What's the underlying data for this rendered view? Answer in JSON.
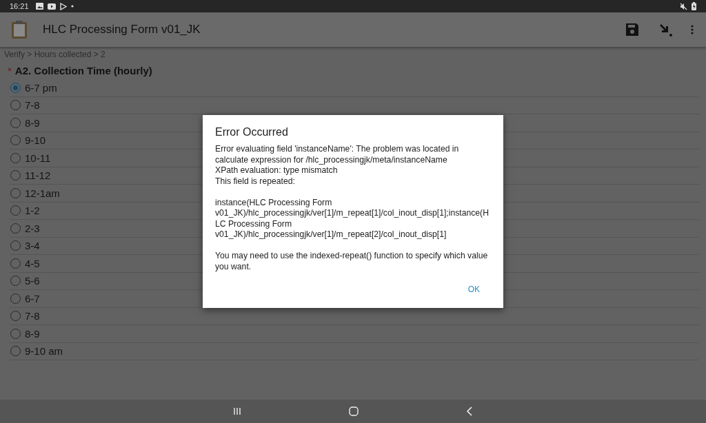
{
  "status_bar": {
    "time": "16:21"
  },
  "app_bar": {
    "title": "HLC Processing Form v01_JK"
  },
  "breadcrumb": "Verify > Hours collected > 2",
  "question": {
    "required": true,
    "required_mark": "*",
    "label": "A2. Collection Time (hourly)"
  },
  "options": [
    {
      "label": "6-7 pm",
      "selected": true
    },
    {
      "label": "7-8",
      "selected": false
    },
    {
      "label": "8-9",
      "selected": false
    },
    {
      "label": "9-10",
      "selected": false
    },
    {
      "label": "10-11",
      "selected": false
    },
    {
      "label": "11-12",
      "selected": false
    },
    {
      "label": "12-1am",
      "selected": false
    },
    {
      "label": "1-2",
      "selected": false
    },
    {
      "label": "2-3",
      "selected": false
    },
    {
      "label": "3-4",
      "selected": false
    },
    {
      "label": "4-5",
      "selected": false
    },
    {
      "label": "5-6",
      "selected": false
    },
    {
      "label": "6-7",
      "selected": false
    },
    {
      "label": "7-8",
      "selected": false
    },
    {
      "label": "8-9",
      "selected": false
    },
    {
      "label": "9-10 am",
      "selected": false
    }
  ],
  "dialog": {
    "title": "Error Occurred",
    "message": "Error evaluating field 'instanceName': The problem was located in calculate expression for /hlc_processingjk/meta/instanceName\nXPath evaluation: type mismatch\nThis field is repeated:\n\ninstance(HLC Processing Form v01_JK)/hlc_processingjk/ver[1]/m_repeat[1]/col_inout_disp[1];instance(HLC Processing Form v01_JK)/hlc_processingjk/ver[1]/m_repeat[2]/col_inout_disp[1]\n\nYou may need to use the indexed-repeat() function to specify which value you want.",
    "button": "OK"
  }
}
